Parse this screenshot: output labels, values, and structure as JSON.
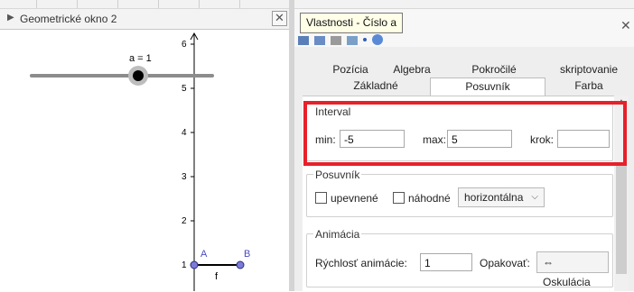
{
  "graphics_view": {
    "title": "Geometrické okno 2",
    "slider_label": "a = 1",
    "axis_ticks": [
      "1",
      "2",
      "3",
      "4",
      "5",
      "6"
    ],
    "segment": {
      "point_a": "A",
      "point_b": "B",
      "label": "f"
    },
    "colors": {
      "point": "#7b7bd9",
      "slider_knob": "#000000",
      "axis": "#000000"
    }
  },
  "properties": {
    "tooltip": "Vlastnosti - Číslo a",
    "tabs_row1": [
      "Pozícia",
      "Algebra",
      "Pokročilé",
      "skriptovanie"
    ],
    "tabs_row2": [
      "Základné",
      "Posuvník",
      "Farba"
    ],
    "active_tab": "Posuvník",
    "interval": {
      "title": "Interval",
      "min_label": "min:",
      "min_value": "-5",
      "max_label": "max:",
      "max_value": "5",
      "step_label": "krok:",
      "step_value": ""
    },
    "slider_group": {
      "title": "Posuvník",
      "fixed_label": "upevnené",
      "fixed_checked": false,
      "random_label": "náhodné",
      "random_checked": false,
      "orientation": "horizontálna"
    },
    "animation": {
      "title": "Animácia",
      "speed_label": "Rýchlosť animácie:",
      "speed_value": "1",
      "repeat_label": "Opakovať:",
      "repeat_value": "⇔ Oskulácia"
    },
    "highlight_color": "#e8202a"
  }
}
